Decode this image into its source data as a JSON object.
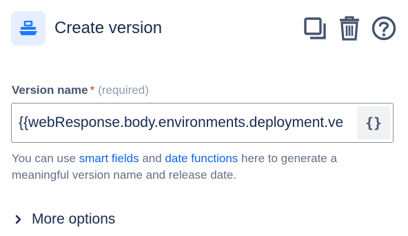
{
  "header": {
    "icon": "boat-icon",
    "title": "Create version",
    "actions": [
      {
        "icon": "copy-icon",
        "label": ""
      },
      {
        "icon": "trash-icon",
        "label": ""
      },
      {
        "icon": "help-icon",
        "label": ""
      }
    ]
  },
  "field": {
    "label": "Version name",
    "required_mark": "*",
    "required_text": "(required)",
    "value": "{{webResponse.body.environments.deployment.ve",
    "smart_value_button": "{}"
  },
  "helper": {
    "prefix": "You can use ",
    "link1": "smart fields",
    "middle": " and ",
    "link2": "date functions",
    "suffix": " here to generate a meaningful version name and release date."
  },
  "more_options": {
    "label": "More options"
  },
  "colors": {
    "text": "#172b4d",
    "subtle": "#44546f",
    "link": "#0c66e4",
    "required": "#c9372c",
    "icon_bg": "#e6efff",
    "icon_fg": "#1d7afc"
  }
}
